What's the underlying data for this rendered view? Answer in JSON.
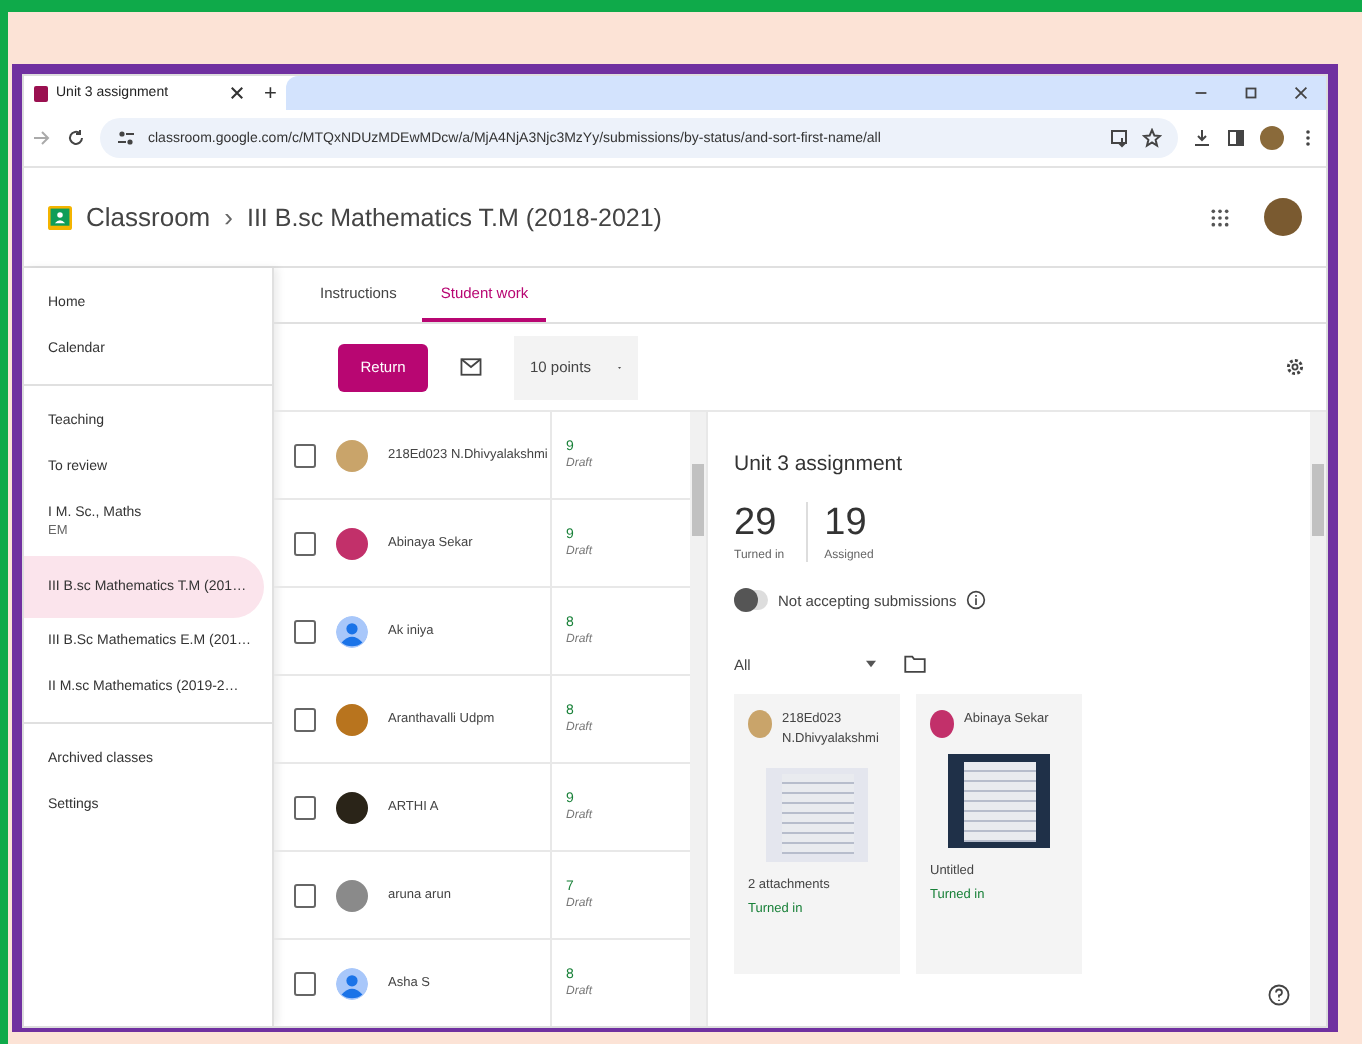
{
  "browser": {
    "tab_title": "Unit 3 assignment",
    "new_tab": "+",
    "url": "classroom.google.com/c/MTQxNDUzMDEwMDcw/a/MjA4NjA3Njc3MzYy/submissions/by-status/and-sort-first-name/all"
  },
  "header": {
    "app": "Classroom",
    "separator": "›",
    "course": "III B.sc Mathematics T.M (2018-2021)"
  },
  "sidebar": {
    "sections": [
      {
        "items": [
          {
            "label": "Home",
            "selected": false
          },
          {
            "label": "Calendar",
            "selected": false
          }
        ]
      },
      {
        "items": [
          {
            "label": "Teaching",
            "selected": false
          },
          {
            "label": "To review",
            "selected": false
          },
          {
            "label": "I M. Sc., Maths",
            "sub": "EM",
            "selected": false
          },
          {
            "label": "III B.sc Mathematics T.M (201…",
            "selected": true
          },
          {
            "label": "III B.Sc Mathematics E.M (201…",
            "selected": false
          },
          {
            "label": "II M.sc Mathematics (2019-2…",
            "selected": false
          }
        ]
      },
      {
        "items": [
          {
            "label": "Archived classes",
            "selected": false
          },
          {
            "label": "Settings",
            "selected": false
          }
        ]
      }
    ]
  },
  "tabs": [
    {
      "label": "Instructions",
      "selected": false
    },
    {
      "label": "Student work",
      "selected": true
    }
  ],
  "toolbar": {
    "return_button": "Return",
    "points": "10 points"
  },
  "students": [
    {
      "name": "218Ed023 N.Dhivyalakshmi",
      "kind": "photo",
      "color": "#c9a46a",
      "grade": "9",
      "status": "Draft",
      "checked": false
    },
    {
      "name": "Abinaya Sekar",
      "kind": "photo",
      "color": "#c2306a",
      "grade": "9",
      "status": "Draft",
      "checked": false
    },
    {
      "name": "Ak iniya",
      "kind": "default",
      "grade": "8",
      "status": "Draft",
      "checked": false
    },
    {
      "name": "Aranthavalli Udpm",
      "kind": "photo",
      "color": "#b8741e",
      "grade": "8",
      "status": "Draft",
      "checked": false
    },
    {
      "name": "ARTHI A",
      "kind": "photo",
      "color": "#2a2418",
      "grade": "9",
      "status": "Draft",
      "checked": false
    },
    {
      "name": "aruna arun",
      "kind": "photo",
      "color": "#8a8a8a",
      "grade": "7",
      "status": "Draft",
      "checked": false
    },
    {
      "name": "Asha S",
      "kind": "default",
      "grade": "8",
      "status": "Draft",
      "checked": false
    }
  ],
  "detail": {
    "title": "Unit 3 assignment",
    "stats": [
      {
        "value": "29",
        "label": "Turned in"
      },
      {
        "value": "19",
        "label": "Assigned"
      }
    ],
    "accepting": {
      "label": "Not accepting submissions",
      "on": false
    },
    "filter": "All",
    "cards": [
      {
        "name_lines": [
          "218Ed023",
          "N.Dhivyalakshmi"
        ],
        "color": "#c9a46a",
        "caption": "2 attachments",
        "status": "Turned in",
        "kind": "light"
      },
      {
        "name_lines": [
          "Abinaya Sekar"
        ],
        "color": "#c2306a",
        "caption": "Untitled",
        "status": "Turned in",
        "kind": "dark"
      }
    ]
  }
}
